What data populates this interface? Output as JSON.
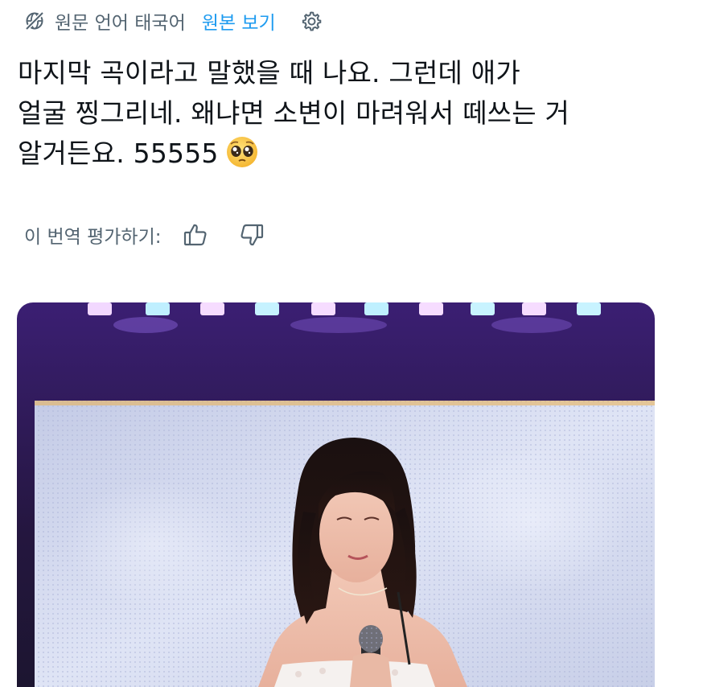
{
  "translation_bar": {
    "source_language": "원문 언어 태국어",
    "show_original": "원본 보기",
    "icon": "globe-slash-icon",
    "settings_icon": "gear-icon",
    "link_color": "#1d9bf0"
  },
  "tweet": {
    "lines": [
      "마지막 곡이라고 말했을 때 나요. 그런데 애가",
      "얼굴 찡그리네. 왜냐면 소변이 마려워서 떼쓰는 거",
      "알거든요. 55555"
    ],
    "emoji": "pleading-face-emoji"
  },
  "rating": {
    "label": "이 번역 평가하기:",
    "like_icon": "thumbs-up-icon",
    "dislike_icon": "thumbs-down-icon"
  },
  "media": {
    "description_icon": "photo",
    "stage_colors": [
      "#2a1a4a",
      "#c9d2ea",
      "#8a4fd8"
    ]
  }
}
